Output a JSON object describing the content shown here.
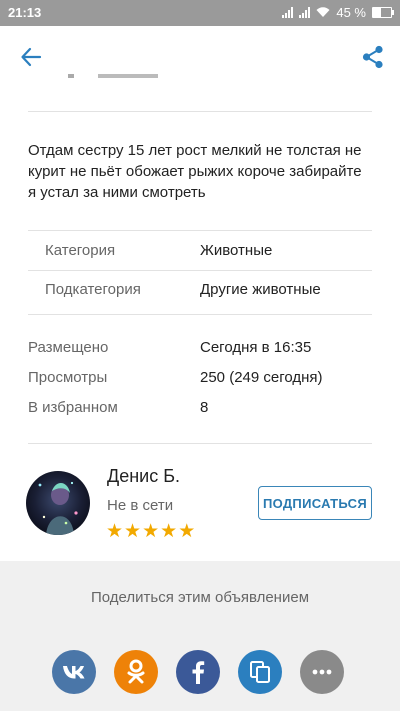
{
  "status_bar": {
    "time": "21:13",
    "battery": "45 %"
  },
  "app_bar": {
    "back_icon": "arrow-left-icon",
    "share_icon": "share-icon",
    "accent": "#2b7fbf"
  },
  "listing": {
    "description": "Отдам сестру 15 лет рост мелкий не толстая не курит не пьёт обожает рыжих короче забирайте я устал за ними смотреть",
    "category_label": "Категория",
    "category_value": "Животные",
    "subcategory_label": "Подкатегория",
    "subcategory_value": "Другие животные",
    "posted_label": "Размещено",
    "posted_value": "Сегодня в 16:35",
    "views_label": "Просмотры",
    "views_value": "250 (249 сегодня)",
    "favorites_label": "В избранном",
    "favorites_value": "8"
  },
  "seller": {
    "name": "Денис Б.",
    "status": "Не в сети",
    "rating": 5,
    "star_color": "#f2a900",
    "subscribe_label": "ПОДПИСАТЬСЯ"
  },
  "share": {
    "title": "Поделиться этим объявлением",
    "buttons": [
      {
        "icon": "vk-icon",
        "color": "#4a76a8"
      },
      {
        "icon": "odnoklassniki-icon",
        "color": "#ee8208"
      },
      {
        "icon": "facebook-icon",
        "color": "#3b5998"
      },
      {
        "icon": "copy-icon",
        "color": "#2b7fbf"
      },
      {
        "icon": "more-icon",
        "color": "#8a8a8a"
      }
    ]
  }
}
